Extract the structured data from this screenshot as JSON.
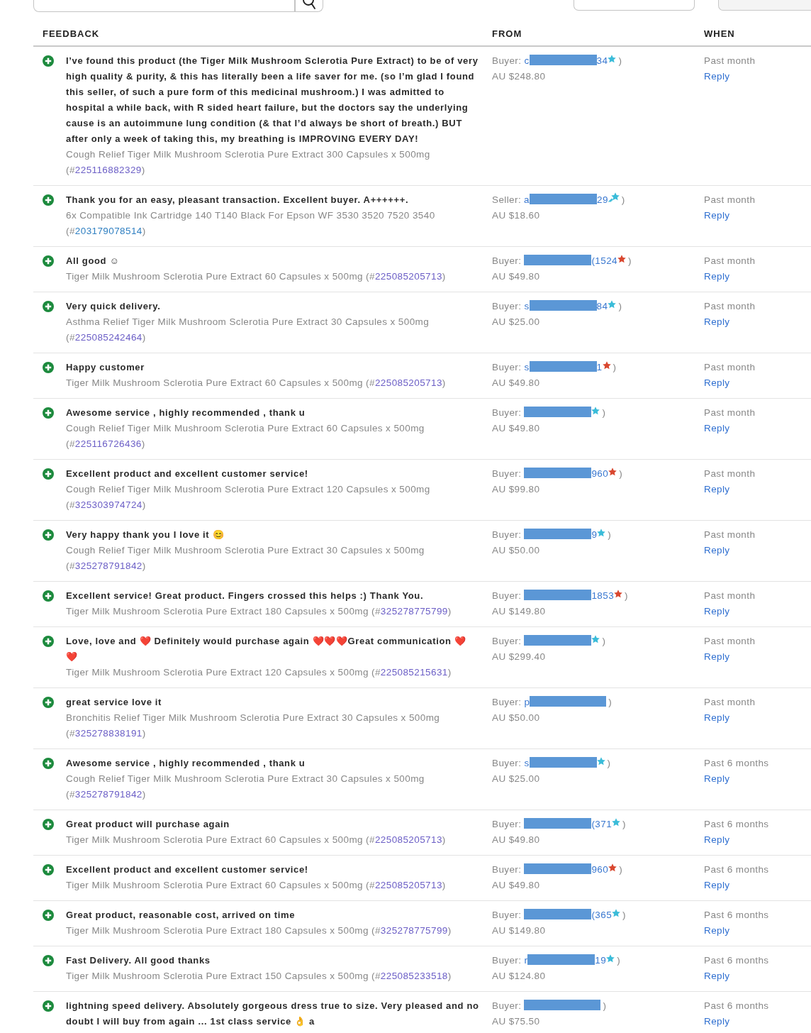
{
  "columns": [
    "FEEDBACK",
    "FROM",
    "WHEN"
  ],
  "rows": [
    {
      "kind": "positive",
      "comment": "I’ve found this product (the Tiger Milk Mushroom Sclerotia Pure Extract) to be of very high quality & purity, & this has literally been a life saver for me. (so I’m glad I found this seller, of such a pure form of this medicinal mushroom.) I was admitted to hospital a while back, with R sided heart failure, but the doctors say the underlying cause is an autoimmune lung condition (& that I’d always be short of breath.) BUT after only a week of taking this, my breathing is IMPROVING EVERY DAY!",
      "item": "Cough Relief Tiger Milk Mushroom Sclerotia Pure Extract 300 Capsules x 500mg (#",
      "item_number": "225116882329",
      "item_end": ")",
      "item_visited": true,
      "role": "Buyer:",
      "name_start": "c",
      "name_redacted": true,
      "score": "34",
      "star": {
        "kind": "plain",
        "color": "#3bbcd9"
      },
      "close": ")",
      "amount": "AU $248.80",
      "when": "Past month",
      "reply": "Reply"
    },
    {
      "kind": "positive",
      "comment": "Thank you for an easy, pleasant transaction. Excellent buyer. A++++++.",
      "item": "6x Compatible Ink Cartridge 140 T140 Black For Epson WF 3530 3520 7520 3540 (#",
      "item_number": "203179078514",
      "item_end": ")",
      "item_visited": false,
      "role": "Seller:",
      "name_start": "a",
      "name_redacted": true,
      "score": "29",
      "star": {
        "kind": "shooting",
        "color": "#3bbcd9"
      },
      "close": ")",
      "amount": "AU $18.60",
      "when": "Past month",
      "reply": "Reply"
    },
    {
      "kind": "positive",
      "comment": "All good ☺",
      "item": "Tiger Milk Mushroom Sclerotia Pure Extract 60 Capsules x 500mg (#",
      "item_number": "225085205713",
      "item_end": ")",
      "item_visited": true,
      "role": "Buyer:",
      "name_redacted": true,
      "score": "(1524",
      "star": {
        "kind": "plain",
        "color": "#d9472f"
      },
      "close": ")",
      "amount": "AU $49.80",
      "when": "Past month",
      "reply": "Reply"
    },
    {
      "kind": "positive",
      "comment": "Very quick delivery.",
      "item": "Asthma Relief Tiger Milk Mushroom Sclerotia Pure Extract 30 Capsules x 500mg (#",
      "item_number": "225085242464",
      "item_end": ")",
      "item_visited": true,
      "role": "Buyer:",
      "name_start": "s",
      "name_redacted": true,
      "score": "84",
      "star": {
        "kind": "plain",
        "color": "#3bbcd9"
      },
      "close": ")",
      "amount": "AU $25.00",
      "when": "Past month",
      "reply": "Reply"
    },
    {
      "kind": "positive",
      "comment": "Happy customer",
      "item": "Tiger Milk Mushroom Sclerotia Pure Extract 60 Capsules x 500mg (#",
      "item_number": "225085205713",
      "item_end": ")",
      "item_visited": true,
      "role": "Buyer:",
      "name_start": "s",
      "name_redacted": true,
      "score": "1",
      "star": {
        "kind": "plain",
        "color": "#d9472f"
      },
      "close": ")",
      "amount": "AU $49.80",
      "when": "Past month",
      "reply": "Reply"
    },
    {
      "kind": "positive",
      "comment": "Awesome service , highly recommended , thank u",
      "item": "Cough Relief Tiger Milk Mushroom Sclerotia Pure Extract 60 Capsules x 500mg (#",
      "item_number": "225116726436",
      "item_end": ")",
      "item_visited": true,
      "role": "Buyer:",
      "name_redacted": true,
      "star": {
        "kind": "plain",
        "color": "#3bbcd9"
      },
      "close": ")",
      "amount": "AU $49.80",
      "when": "Past month",
      "reply": "Reply"
    },
    {
      "kind": "positive",
      "comment": "Excellent product and excellent customer service!",
      "item": "Cough Relief Tiger Milk Mushroom Sclerotia Pure Extract 120 Capsules x 500mg (#",
      "item_number": "325303974724",
      "item_end": ")",
      "item_visited": true,
      "role": "Buyer:",
      "name_redacted": true,
      "score": "960",
      "star": {
        "kind": "plain",
        "color": "#d9472f"
      },
      "close": ")",
      "amount": "AU $99.80",
      "when": "Past month",
      "reply": "Reply"
    },
    {
      "kind": "positive",
      "comment": "Very happy thank you I love it 😊",
      "item": "Cough Relief Tiger Milk Mushroom Sclerotia Pure Extract 30 Capsules x 500mg (#",
      "item_number": "325278791842",
      "item_end": ")",
      "item_visited": true,
      "role": "Buyer:",
      "name_redacted": true,
      "score": "9",
      "star": {
        "kind": "plain",
        "color": "#3bbcd9"
      },
      "close": ")",
      "amount": "AU $50.00",
      "when": "Past month",
      "reply": "Reply"
    },
    {
      "kind": "positive",
      "comment": "Excellent service! Great product. Fingers crossed this helps :) Thank You.",
      "item": "Tiger Milk Mushroom Sclerotia Pure Extract 180 Capsules x 500mg (#",
      "item_number": "325278775799",
      "item_end": ")",
      "item_visited": true,
      "role": "Buyer:",
      "name_redacted": true,
      "score": "1853",
      "star": {
        "kind": "plain",
        "color": "#d9472f"
      },
      "close": ")",
      "amount": "AU $149.80",
      "when": "Past month",
      "reply": "Reply"
    },
    {
      "kind": "positive",
      "comment": "Love, love and ❤️ Definitely would purchase again ❤️❤️❤️Great communication ❤️ ❤️",
      "item": "Tiger Milk Mushroom Sclerotia Pure Extract 120 Capsules x 500mg (#",
      "item_number": "225085215631",
      "item_end": ")",
      "item_visited": true,
      "role": "Buyer:",
      "name_redacted": true,
      "star": {
        "kind": "plain",
        "color": "#3bbcd9"
      },
      "close": ")",
      "amount": "AU $299.40",
      "when": "Past month",
      "reply": "Reply"
    },
    {
      "kind": "positive",
      "comment": "great service love it",
      "item": "Bronchitis Relief Tiger Milk Mushroom Sclerotia Pure Extract 30 Capsules x 500mg (#",
      "item_number": "325278838191",
      "item_end": ")",
      "item_visited": true,
      "role": "Buyer:",
      "name_start": "p",
      "name_redacted": true,
      "close": ")",
      "amount": "AU $50.00",
      "when": "Past month",
      "reply": "Reply"
    },
    {
      "kind": "positive",
      "comment": "Awesome service , highly recommended , thank u",
      "item": "Cough Relief Tiger Milk Mushroom Sclerotia Pure Extract 30 Capsules x 500mg (#",
      "item_number": "325278791842",
      "item_end": ")",
      "item_visited": true,
      "role": "Buyer:",
      "name_start": "s",
      "name_redacted": true,
      "star": {
        "kind": "plain",
        "color": "#3bbcd9"
      },
      "close": ")",
      "amount": "AU $25.00",
      "when": "Past 6 months",
      "reply": "Reply"
    },
    {
      "kind": "positive",
      "comment": "Great product will purchase again",
      "item": "Tiger Milk Mushroom Sclerotia Pure Extract 60 Capsules x 500mg (#",
      "item_number": "225085205713",
      "item_end": ")",
      "item_visited": true,
      "role": "Buyer:",
      "name_redacted": true,
      "score": "(371",
      "star": {
        "kind": "plain",
        "color": "#3bbcd9"
      },
      "close": ")",
      "amount": "AU $49.80",
      "when": "Past 6 months",
      "reply": "Reply"
    },
    {
      "kind": "positive",
      "comment": "Excellent product and excellent customer service!",
      "item": "Tiger Milk Mushroom Sclerotia Pure Extract 60 Capsules x 500mg (#",
      "item_number": "225085205713",
      "item_end": ")",
      "item_visited": true,
      "role": "Buyer:",
      "name_redacted": true,
      "score": "960",
      "star": {
        "kind": "plain",
        "color": "#d9472f"
      },
      "close": ")",
      "amount": "AU $49.80",
      "when": "Past 6 months",
      "reply": "Reply"
    },
    {
      "kind": "positive",
      "comment": "Great product, reasonable cost, arrived on time",
      "item": "Tiger Milk Mushroom Sclerotia Pure Extract 180 Capsules x 500mg (#",
      "item_number": "325278775799",
      "item_end": ")",
      "item_visited": true,
      "role": "Buyer:",
      "name_redacted": true,
      "score": "(365",
      "star": {
        "kind": "plain",
        "color": "#3bbcd9"
      },
      "close": ")",
      "amount": "AU $149.80",
      "when": "Past 6 months",
      "reply": "Reply"
    },
    {
      "kind": "positive",
      "comment": "Fast Delivery. All good thanks",
      "item": "Tiger Milk Mushroom Sclerotia Pure Extract 150 Capsules x 500mg (#",
      "item_number": "225085233518",
      "item_end": ")",
      "item_visited": true,
      "role": "Buyer:",
      "name_start": "r",
      "name_redacted": true,
      "score": "19",
      "star": {
        "kind": "plain",
        "color": "#3bbcd9"
      },
      "close": ")",
      "amount": "AU $124.80",
      "when": "Past 6 months",
      "reply": "Reply"
    },
    {
      "kind": "positive",
      "comment": "lightning speed delivery. Absolutely gorgeous dress true to size. Very pleased and no doubt I will buy from again ... 1st class service 👌 a",
      "role": "Buyer:",
      "name_redacted": true,
      "close": ")",
      "amount": "AU $75.50",
      "when": "Past 6 months",
      "reply": "Reply"
    }
  ]
}
